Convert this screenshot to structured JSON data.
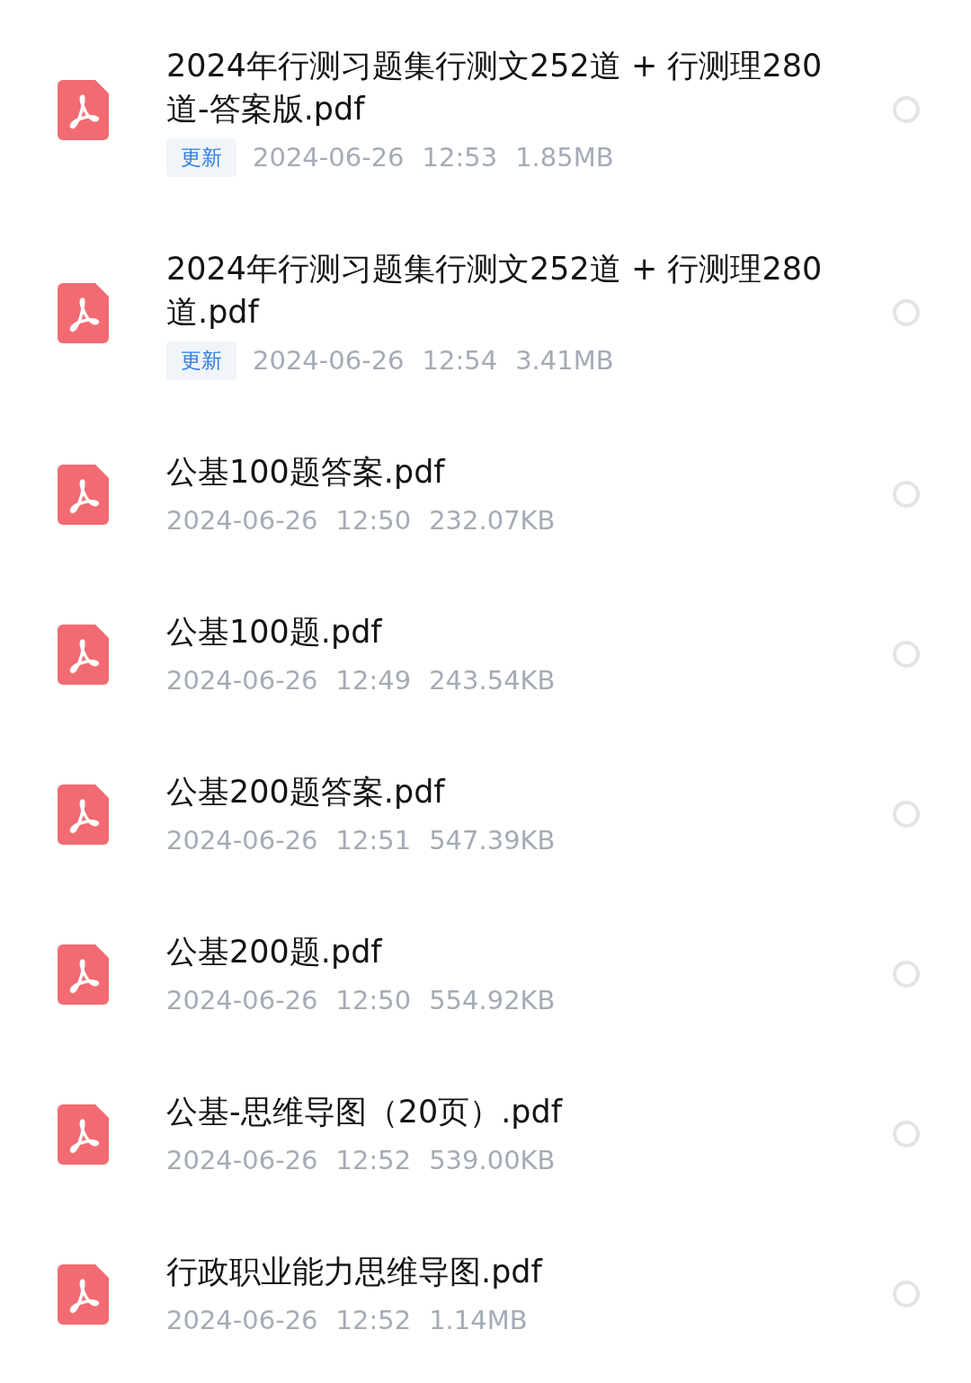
{
  "files": [
    {
      "name": "2024年行测习题集行测文252道 + 行测理280道-答案版.pdf",
      "badge": "更新",
      "date": "2024-06-26",
      "time": "12:53",
      "size": "1.85MB",
      "selected": false
    },
    {
      "name": "2024年行测习题集行测文252道 + 行测理280道.pdf",
      "badge": "更新",
      "date": "2024-06-26",
      "time": "12:54",
      "size": "3.41MB",
      "selected": false
    },
    {
      "name": "公基100题答案.pdf",
      "date": "2024-06-26",
      "time": "12:50",
      "size": "232.07KB",
      "selected": false
    },
    {
      "name": "公基100题.pdf",
      "date": "2024-06-26",
      "time": "12:49",
      "size": "243.54KB",
      "selected": false
    },
    {
      "name": "公基200题答案.pdf",
      "date": "2024-06-26",
      "time": "12:51",
      "size": "547.39KB",
      "selected": false
    },
    {
      "name": "公基200题.pdf",
      "date": "2024-06-26",
      "time": "12:50",
      "size": "554.92KB",
      "selected": false
    },
    {
      "name": "公基-思维导图（20页）.pdf",
      "date": "2024-06-26",
      "time": "12:52",
      "size": "539.00KB",
      "selected": false
    },
    {
      "name": "行政职业能力思维导图.pdf",
      "date": "2024-06-26",
      "time": "12:52",
      "size": "1.14MB",
      "selected": false
    }
  ]
}
